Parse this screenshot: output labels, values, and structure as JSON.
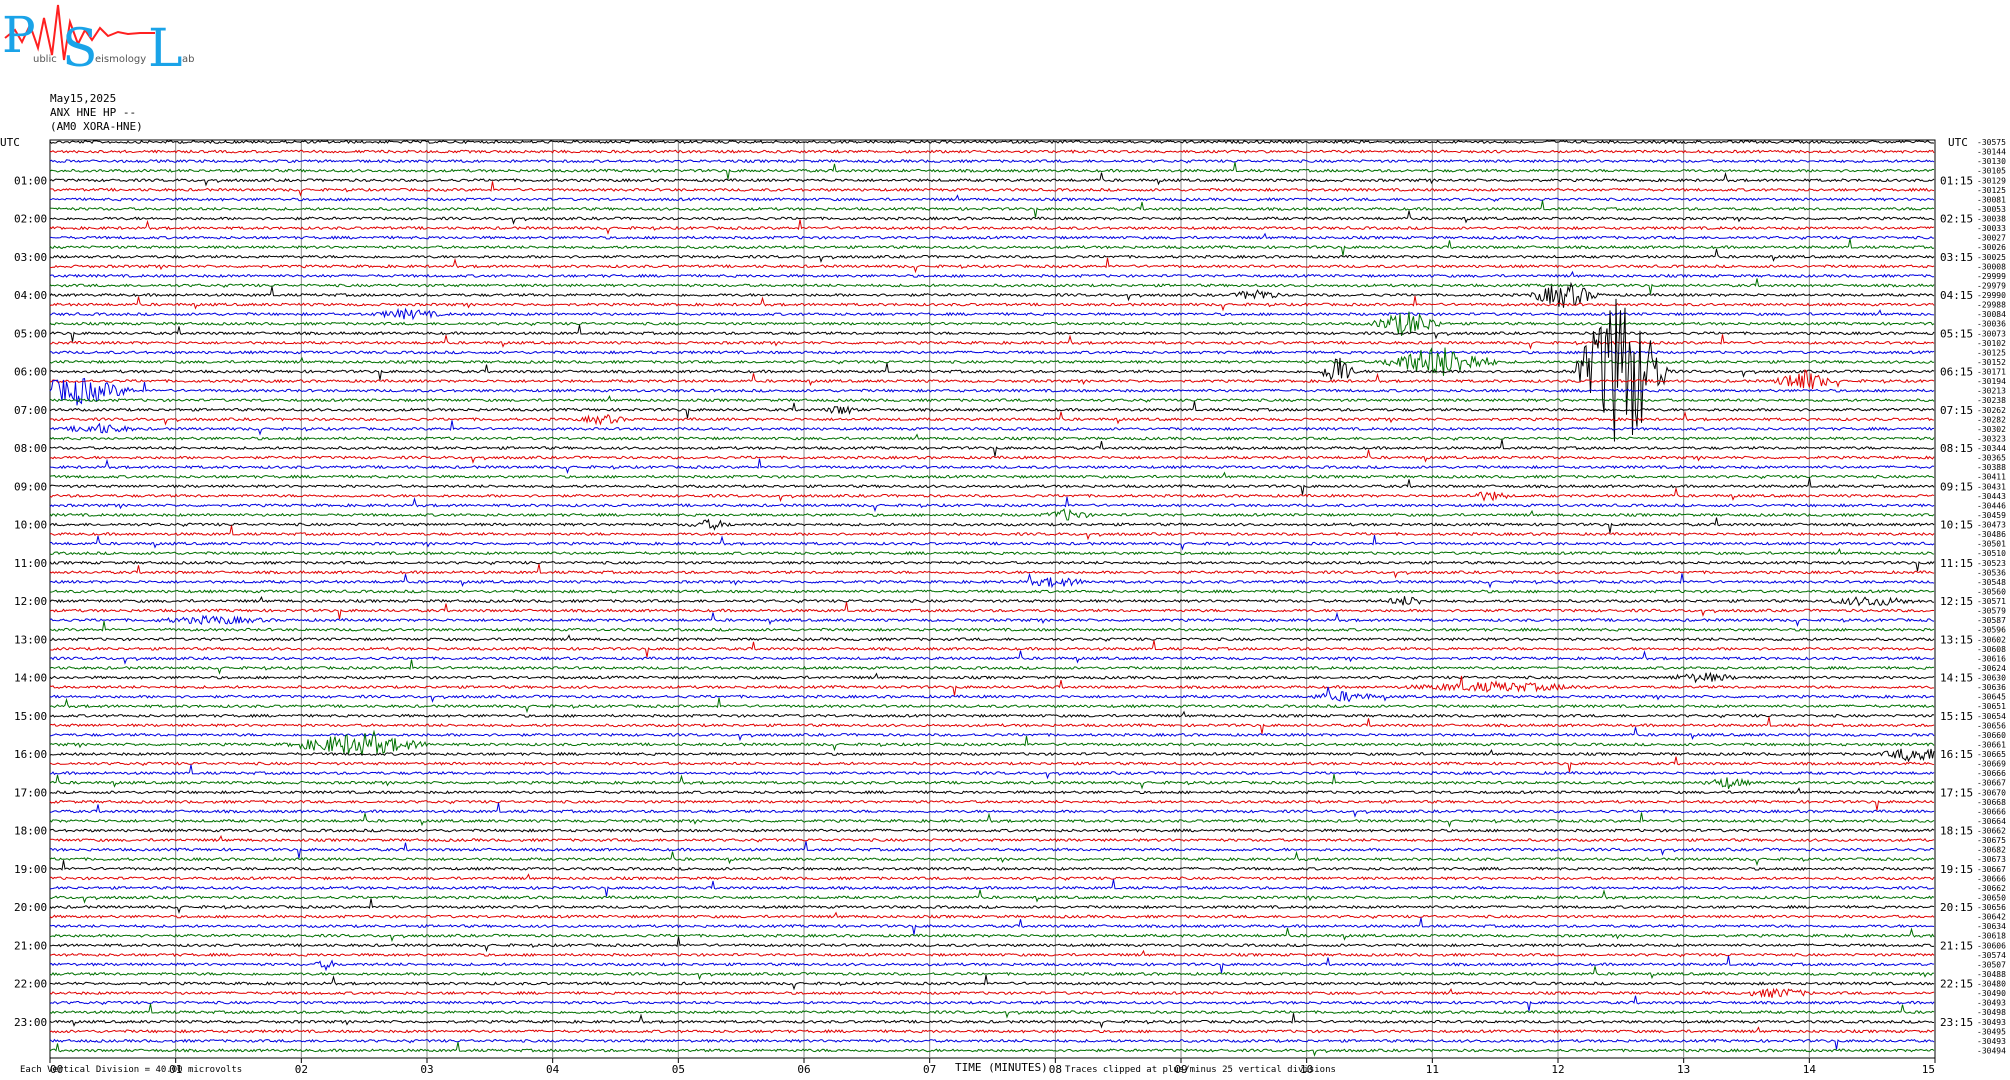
{
  "logo": {
    "letters": [
      "P",
      "S",
      "L"
    ],
    "subtext": [
      "ublic",
      "eismology",
      "ab"
    ],
    "colors": {
      "letters": "#1aa3e8",
      "trace": "#ff2020"
    }
  },
  "header": {
    "date": "May15,2025",
    "station": "ANX HNE HP --",
    "channel": "(AM0 XORA-HNE)"
  },
  "chart_data": {
    "type": "line",
    "subtype": "helicorder",
    "xlabel": "TIME (MINUTES)",
    "xlim": [
      0,
      15
    ],
    "x_ticks": [
      "00",
      "01",
      "02",
      "03",
      "04",
      "05",
      "06",
      "07",
      "08",
      "09",
      "10",
      "11",
      "12",
      "13",
      "14",
      "15"
    ],
    "left_axis_title": "UTC",
    "right_axis_title": "UTC",
    "left_hours": [
      "01:00",
      "02:00",
      "03:00",
      "04:00",
      "05:00",
      "06:00",
      "07:00",
      "08:00",
      "09:00",
      "10:00",
      "11:00",
      "12:00",
      "13:00",
      "14:00",
      "15:00",
      "16:00",
      "17:00",
      "18:00",
      "19:00",
      "20:00",
      "21:00",
      "22:00",
      "23:00"
    ],
    "right_hours": [
      "01:15",
      "02:15",
      "03:15",
      "04:15",
      "05:15",
      "06:15",
      "07:15",
      "08:15",
      "09:15",
      "10:15",
      "11:15",
      "12:15",
      "13:15",
      "14:15",
      "15:15",
      "16:15",
      "17:15",
      "18:15",
      "19:15",
      "20:15",
      "21:15",
      "22:15",
      "23:15"
    ],
    "trace_count": 96,
    "trace_colors": [
      "#000000",
      "#e00000",
      "#0000e0",
      "#007000"
    ],
    "right_offsets": [
      "-30575",
      "-30144",
      "-30130",
      "-30105",
      "-30129",
      "-30125",
      "-30081",
      "-30053",
      "-30038",
      "-30033",
      "-30027",
      "-30026",
      "-30025",
      "-30008",
      "-29999",
      "-29979",
      "-29990",
      "-29988",
      "-30084",
      "-30036",
      "-30073",
      "-30102",
      "-30125",
      "-30152",
      "-30171",
      "-30194",
      "-30213",
      "-30238",
      "-30262",
      "-30282",
      "-30302",
      "-30323",
      "-30344",
      "-30365",
      "-30388",
      "-30411",
      "-30431",
      "-30443",
      "-30446",
      "-30459",
      "-30473",
      "-30486",
      "-30501",
      "-30510",
      "-30523",
      "-30536",
      "-30548",
      "-30560",
      "-30571",
      "-30579",
      "-30587",
      "-30596",
      "-30602",
      "-30608",
      "-30616",
      "-30624",
      "-30630",
      "-30636",
      "-30645",
      "-30651",
      "-30654",
      "-30656",
      "-30660",
      "-30661",
      "-30665",
      "-30669",
      "-30666",
      "-30667",
      "-30670",
      "-30668",
      "-30666",
      "-30664",
      "-30662",
      "-30675",
      "-30682",
      "-30673",
      "-30667",
      "-30666",
      "-30662",
      "-30650",
      "-30656",
      "-30642",
      "-30634",
      "-30618",
      "-30606",
      "-30574",
      "-30507",
      "-30488",
      "-30480",
      "-30490",
      "-30493",
      "-30498",
      "-30493",
      "-30495",
      "-30493",
      "-30494"
    ],
    "events": [
      {
        "trace": 24,
        "minute": 12.5,
        "amplitude": 10,
        "width": 0.4
      },
      {
        "trace": 26,
        "minute": 0.2,
        "amplitude": 1.6,
        "width": 0.5
      },
      {
        "trace": 16,
        "minute": 12.05,
        "amplitude": 1.5,
        "width": 0.3
      },
      {
        "trace": 19,
        "minute": 10.8,
        "amplitude": 1.5,
        "width": 0.3
      },
      {
        "trace": 24,
        "minute": 10.25,
        "amplitude": 2.0,
        "width": 0.15
      },
      {
        "trace": 23,
        "minute": 11.05,
        "amplitude": 1.8,
        "width": 0.5
      },
      {
        "trace": 25,
        "minute": 13.95,
        "amplitude": 1.3,
        "width": 0.25
      },
      {
        "trace": 63,
        "minute": 2.45,
        "amplitude": 1.3,
        "width": 0.6
      },
      {
        "trace": 64,
        "minute": 14.85,
        "amplitude": 0.9,
        "width": 0.3
      },
      {
        "trace": 67,
        "minute": 13.35,
        "amplitude": 0.6,
        "width": 0.2
      },
      {
        "trace": 57,
        "minute": 11.5,
        "amplitude": 0.5,
        "width": 0.8
      },
      {
        "trace": 16,
        "minute": 9.6,
        "amplitude": 0.6,
        "width": 0.2
      },
      {
        "trace": 18,
        "minute": 2.85,
        "amplitude": 0.5,
        "width": 0.3
      },
      {
        "trace": 28,
        "minute": 6.3,
        "amplitude": 0.5,
        "width": 0.15
      },
      {
        "trace": 29,
        "minute": 4.4,
        "amplitude": 0.5,
        "width": 0.2
      },
      {
        "trace": 30,
        "minute": 0.4,
        "amplitude": 0.5,
        "width": 0.3
      },
      {
        "trace": 37,
        "minute": 11.45,
        "amplitude": 0.5,
        "width": 0.2
      },
      {
        "trace": 39,
        "minute": 8.1,
        "amplitude": 0.6,
        "width": 0.2
      },
      {
        "trace": 40,
        "minute": 5.25,
        "amplitude": 0.5,
        "width": 0.2
      },
      {
        "trace": 46,
        "minute": 8.0,
        "amplitude": 0.5,
        "width": 0.3
      },
      {
        "trace": 48,
        "minute": 10.8,
        "amplitude": 0.5,
        "width": 0.2
      },
      {
        "trace": 48,
        "minute": 14.5,
        "amplitude": 0.5,
        "width": 0.4
      },
      {
        "trace": 50,
        "minute": 1.3,
        "amplitude": 0.4,
        "width": 0.5
      },
      {
        "trace": 56,
        "minute": 13.15,
        "amplitude": 0.5,
        "width": 0.3
      },
      {
        "trace": 58,
        "minute": 10.3,
        "amplitude": 0.5,
        "width": 0.3
      },
      {
        "trace": 86,
        "minute": 2.2,
        "amplitude": 0.5,
        "width": 0.1
      },
      {
        "trace": 89,
        "minute": 13.75,
        "amplitude": 0.5,
        "width": 0.3
      }
    ],
    "grid": true
  },
  "footer": {
    "division_note": "Each Vertical Division =    40.00 microvolts",
    "clip_note": "Traces clipped at plus/minus 25 vertical divisions"
  }
}
